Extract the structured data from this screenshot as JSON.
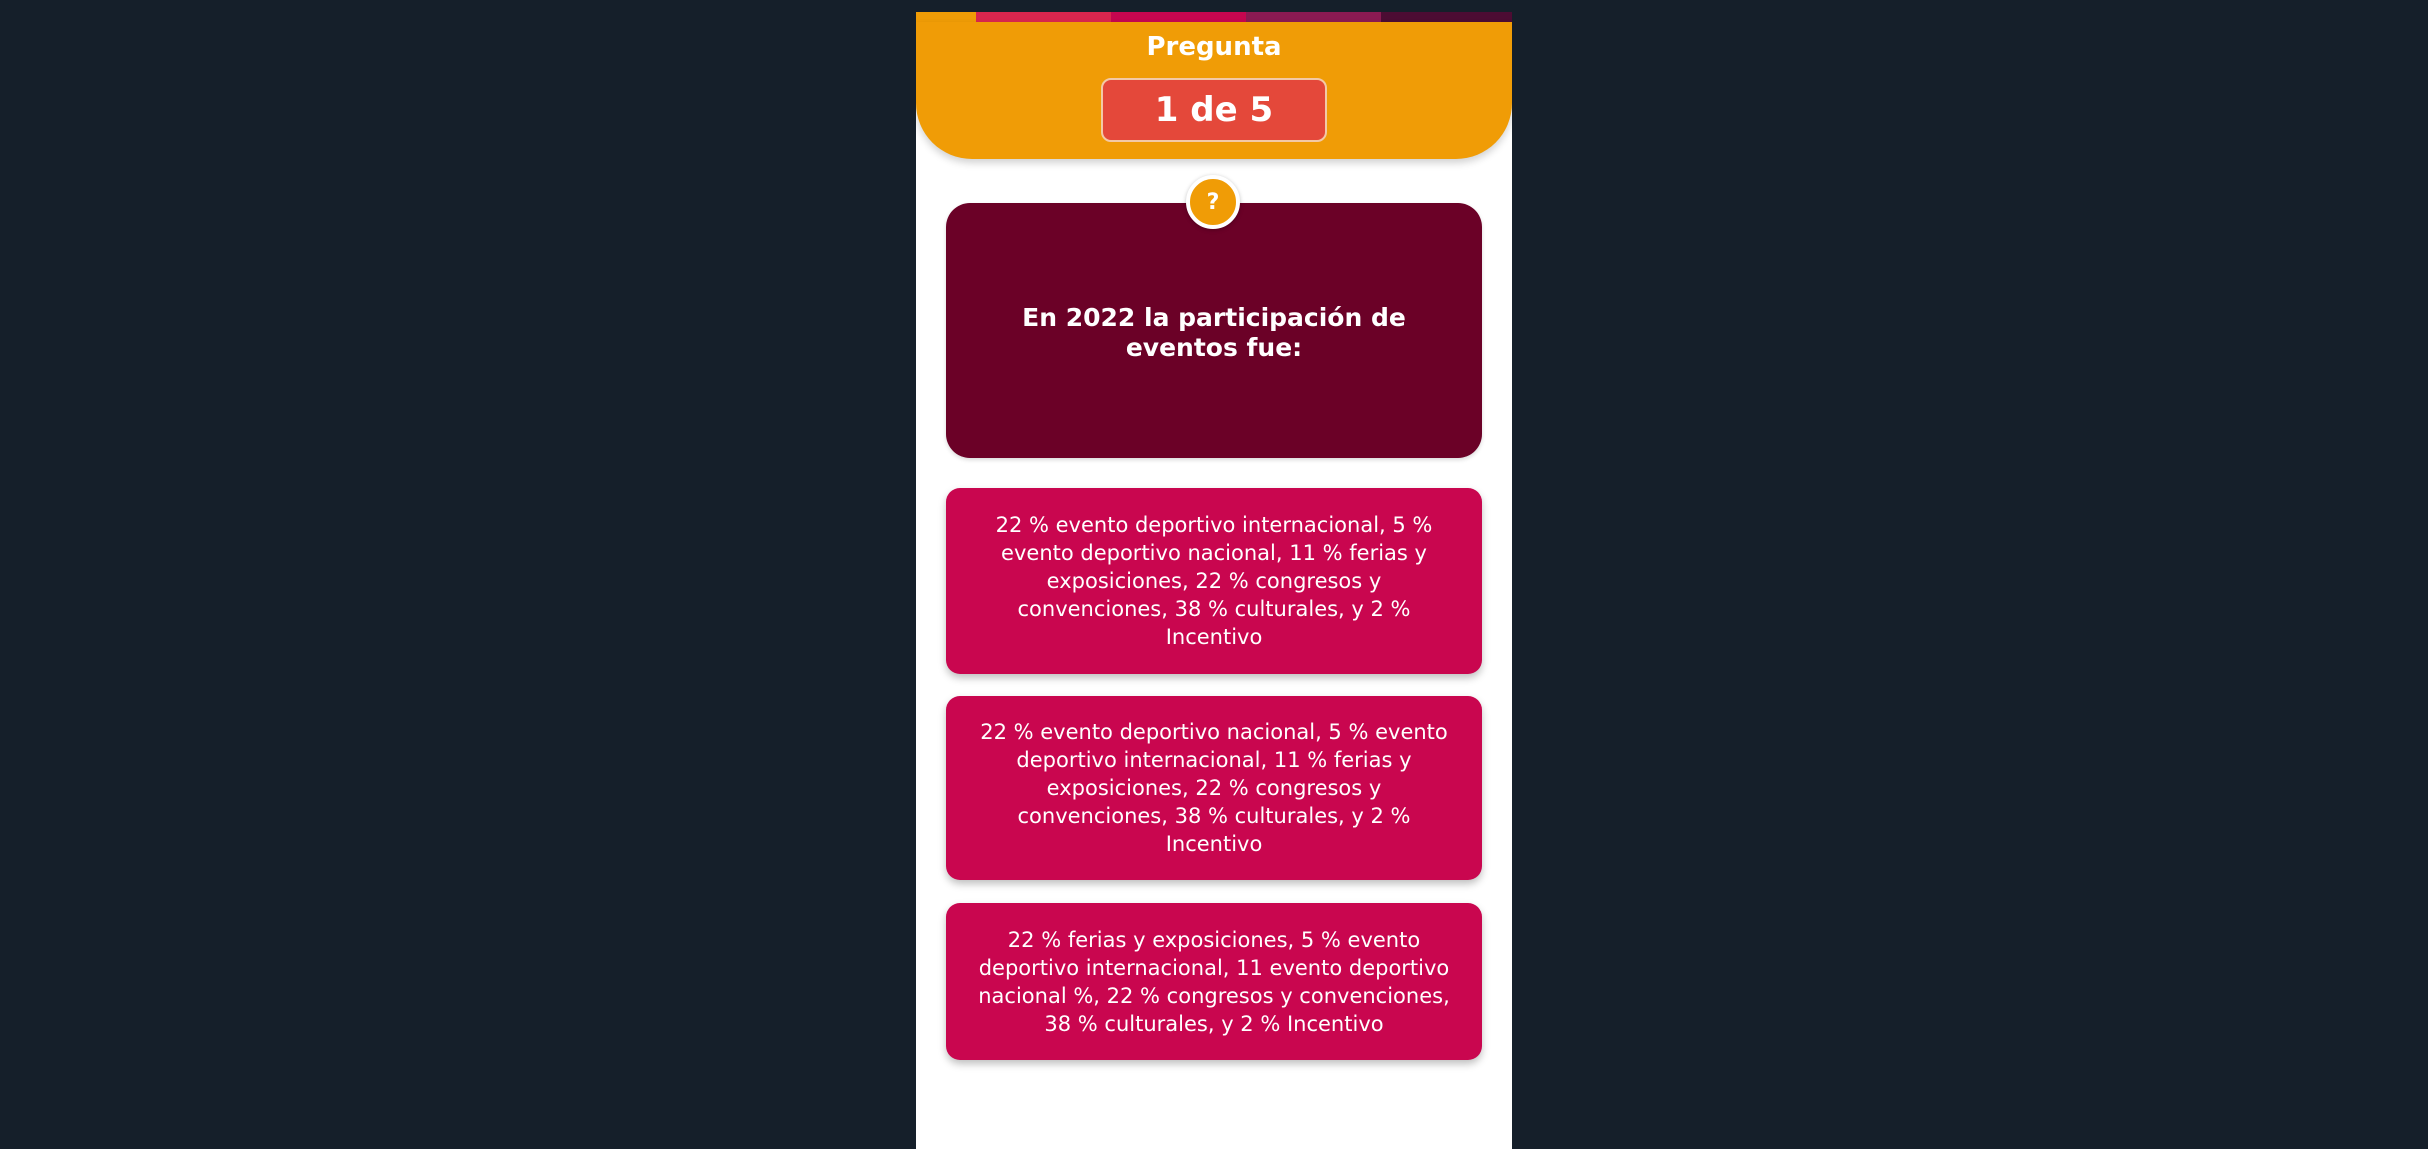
{
  "header": {
    "title": "Pregunta",
    "counter": "1 de 5"
  },
  "question": {
    "badge": "?",
    "text": "En 2022 la participación de eventos fue:"
  },
  "answers": [
    {
      "text": "22 % evento deportivo internacional, 5 % evento deportivo nacional, 11 % ferias y exposiciones, 22 % congresos y convenciones, 38 % culturales, y 2 % Incentivo"
    },
    {
      "text": "22 % evento deportivo nacional, 5 % evento deportivo internacional, 11 % ferias y exposiciones, 22 % congresos y convenciones, 38 % culturales, y 2 % Incentivo"
    },
    {
      "text": "22 % ferias y exposiciones, 5 % evento deportivo internacional, 11 evento deportivo nacional %, 22 % congresos y convenciones, 38 % culturales, y 2 % Incentivo"
    }
  ],
  "colors": {
    "page_background": "#151f2a",
    "header": "#f09c06",
    "counter_box": "#e4483a",
    "question_card": "#6b0127",
    "answer_card": "#c9064f",
    "progress_segments": [
      "#f09c06",
      "#d9264e",
      "#c6064f",
      "#8b1a52",
      "#4c0c33"
    ]
  }
}
